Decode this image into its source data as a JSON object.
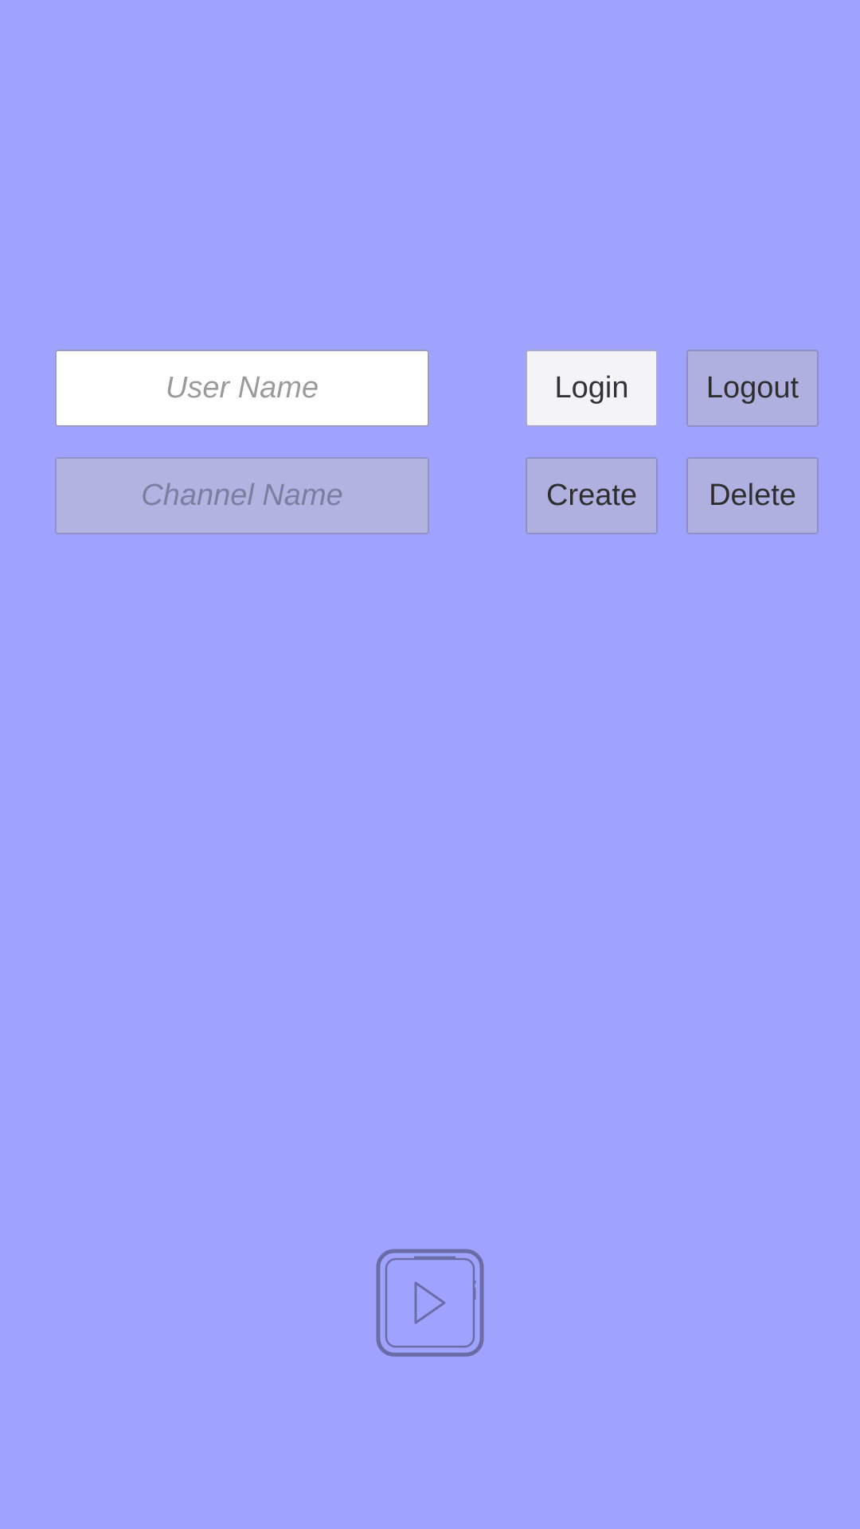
{
  "form": {
    "username_placeholder": "User Name",
    "channel_placeholder": "Channel Name"
  },
  "buttons": {
    "login": "Login",
    "logout": "Logout",
    "create": "Create",
    "delete": "Delete"
  },
  "icons": {
    "play": "play-icon"
  },
  "colors": {
    "background": "#a0a3fe",
    "active_button": "#f4f4f6",
    "inactive_button": "#b0b0e0",
    "icon_stroke": "#6a6ca8"
  }
}
